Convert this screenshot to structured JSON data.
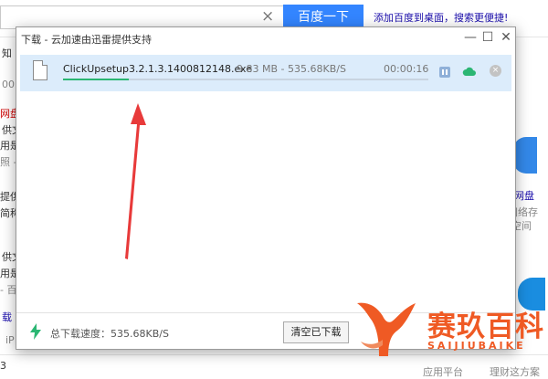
{
  "background": {
    "search_button": "百度一下",
    "top_link": "添加百度到桌面，搜索更便捷!",
    "clear_icon": "×",
    "left_fragments": [
      "知",
      "00",
      "网盘",
      "供文",
      "用是",
      "照 -",
      "提供",
      "简称",
      "供文",
      "用是",
      "- 百",
      "载",
      "iP",
      "3"
    ],
    "right_fragments": [
      "网盘",
      "间络存",
      "空间",
      "应用平台",
      "理财这方案"
    ]
  },
  "dialog": {
    "title": "下载 - 云加速由迅雷提供支持",
    "controls": {
      "minimize": "—",
      "maximize": "☐",
      "close": "✕"
    },
    "download": {
      "filename": "ClickUpsetup3.2.1.3.1400812148.exe",
      "status": "9.83 MB - 535.68KB/S",
      "time": "00:00:16",
      "progress": 0.18,
      "delete_icon": "×"
    },
    "footer": {
      "speed_text": "总下载速度：535.68KB/S",
      "clear_button": "清空已下载"
    }
  },
  "watermark": {
    "text": "赛玖百科",
    "subtext": "SAIJIUBAIKE"
  },
  "colors": {
    "accent": "#3385ff",
    "progress": "#2bb673",
    "row_highlight": "#dcecfb",
    "arrow": "#e83a3a",
    "watermark": "#ef5a24"
  }
}
